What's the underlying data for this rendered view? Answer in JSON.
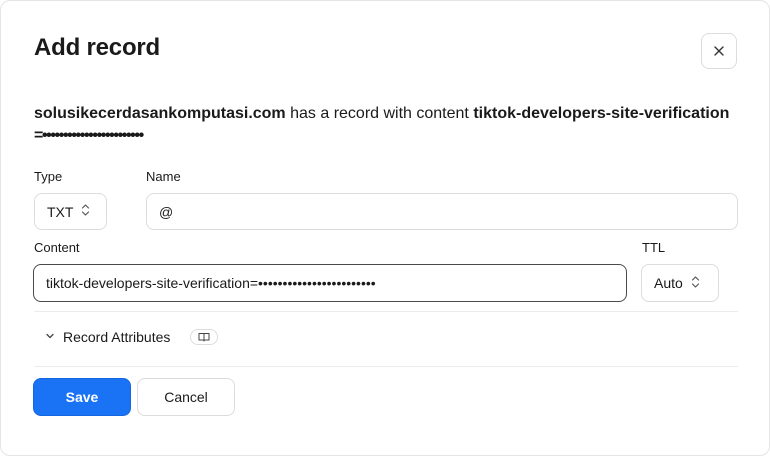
{
  "dialog": {
    "title": "Add record",
    "close_icon": "close-icon"
  },
  "summary": {
    "domain": "solusikecerdasankomputasi.com",
    "middle_text": " has a record with content ",
    "content_prefix": "tiktok-developers-site-verification",
    "content_suffix": "=••••••••••••••••••••••••"
  },
  "fields": {
    "type": {
      "label": "Type",
      "value": "TXT"
    },
    "name": {
      "label": "Name",
      "value": "@"
    },
    "content": {
      "label": "Content",
      "value": "tiktok-developers-site-verification=••••••••••••••••••••••••"
    },
    "ttl": {
      "label": "TTL",
      "value": "Auto"
    }
  },
  "record_attributes": {
    "label": "Record Attributes",
    "icon": "book-icon"
  },
  "actions": {
    "save_label": "Save",
    "cancel_label": "Cancel"
  },
  "colors": {
    "primary": "#1a73f5",
    "border": "#dcdcdc"
  }
}
